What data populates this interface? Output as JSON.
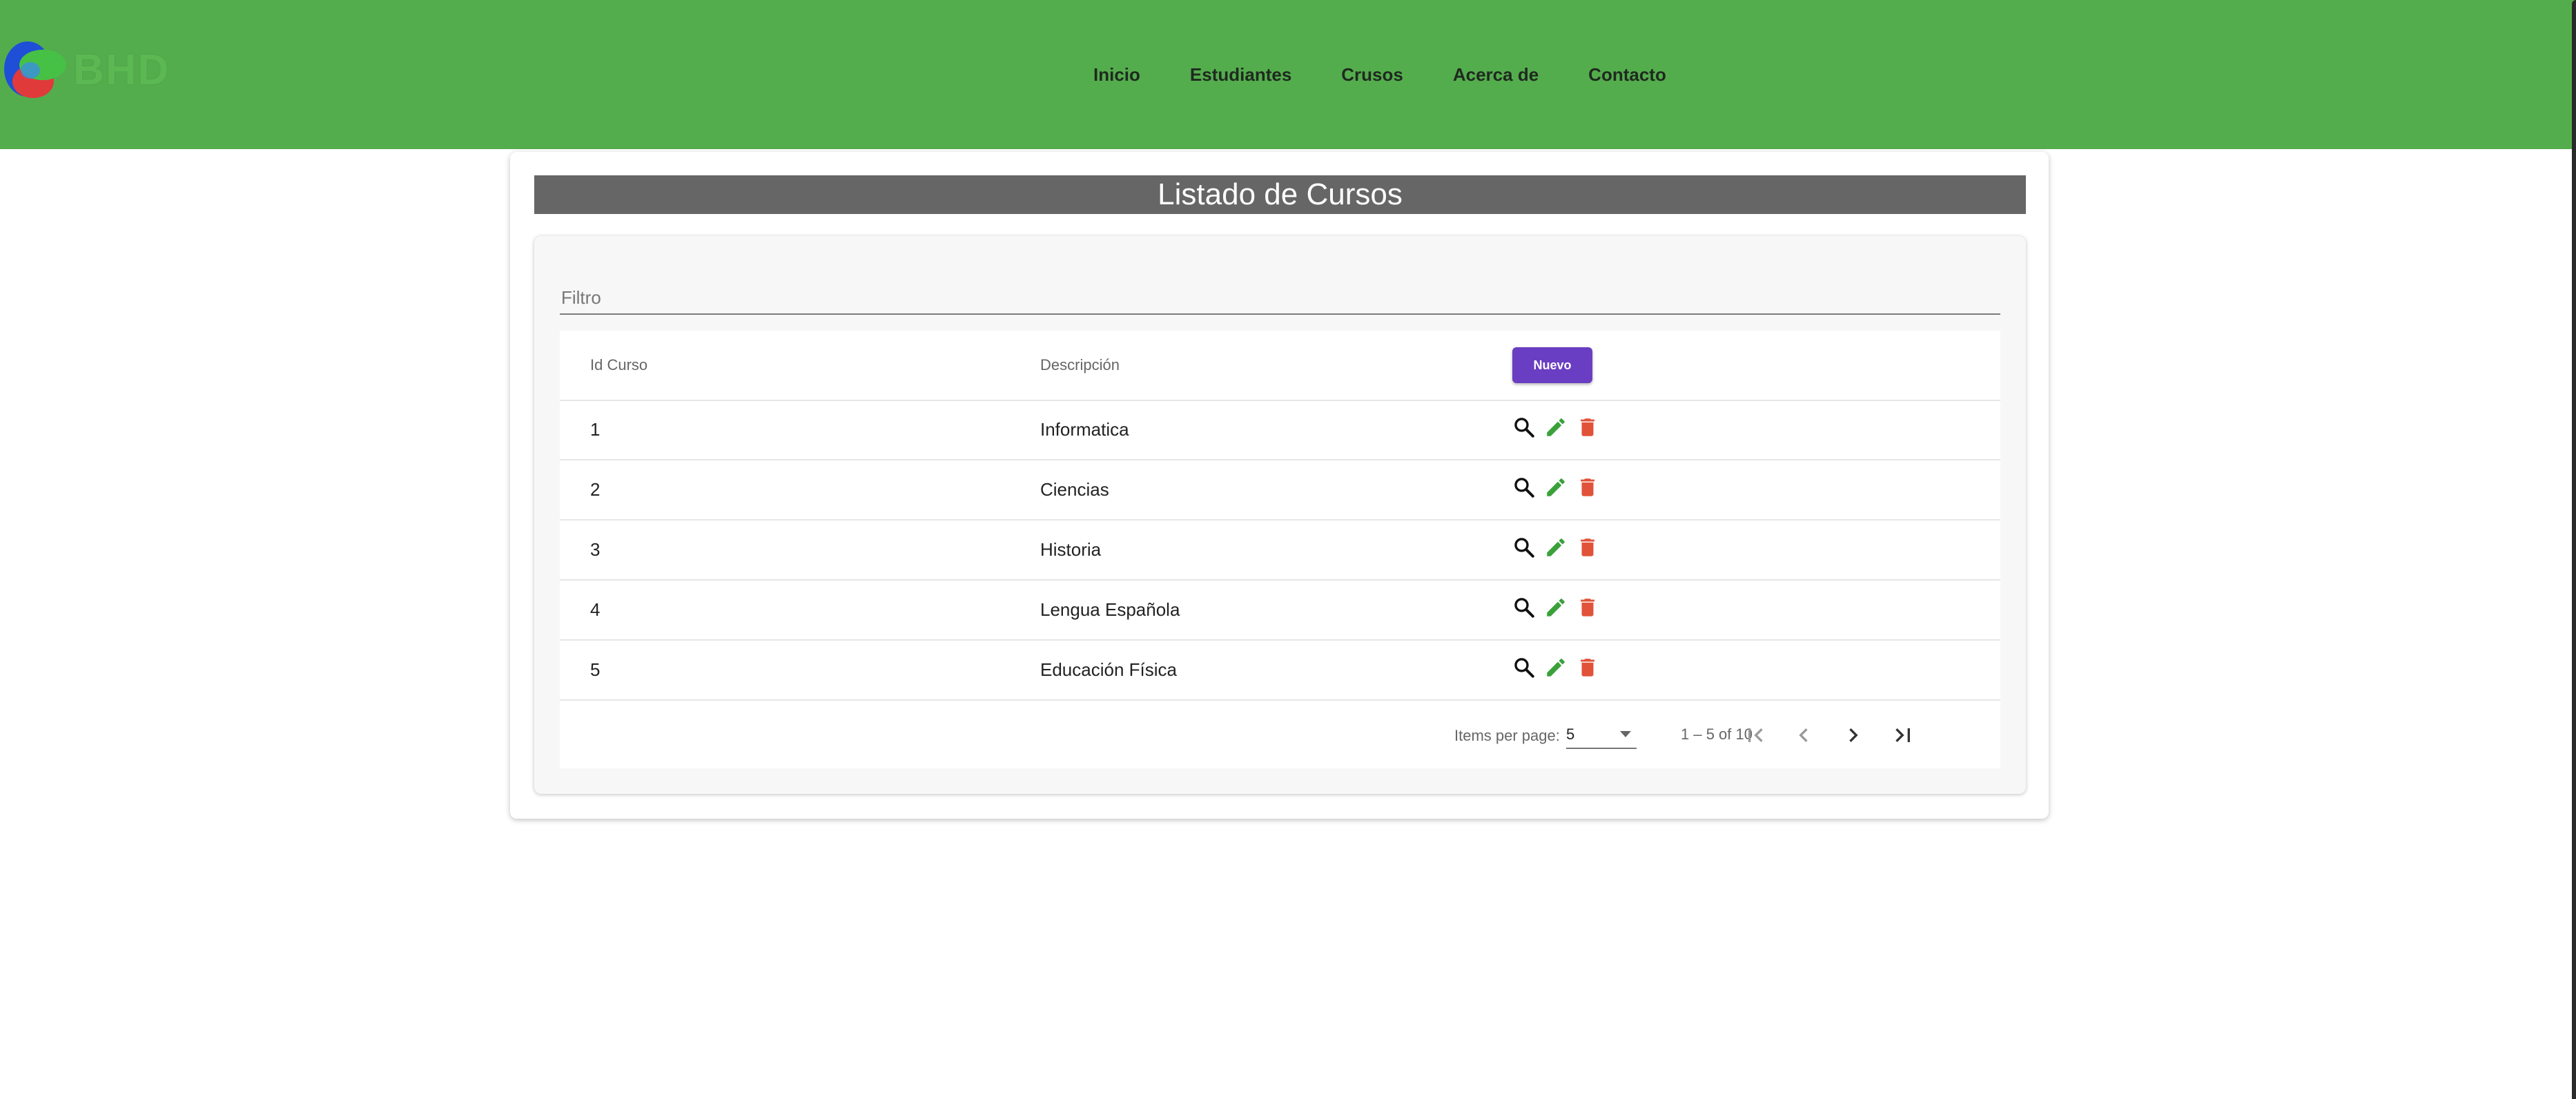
{
  "app": {
    "logo_text": "BHD",
    "colors": {
      "header": "#54ad4d",
      "primary_button": "#6a3ec2",
      "edit": "#3aa13a",
      "delete": "#e0533a"
    }
  },
  "nav": {
    "items": [
      "Inicio",
      "Estudiantes",
      "Crusos",
      "Acerca de",
      "Contacto"
    ]
  },
  "page": {
    "title": "Listado de Cursos"
  },
  "filter": {
    "placeholder": "Filtro",
    "value": ""
  },
  "table": {
    "headers": {
      "id": "Id Curso",
      "description": "Descripción",
      "new_button": "Nuevo"
    },
    "rows": [
      {
        "id": "1",
        "description": "Informatica"
      },
      {
        "id": "2",
        "description": "Ciencias"
      },
      {
        "id": "3",
        "description": "Historia"
      },
      {
        "id": "4",
        "description": "Lengua Española"
      },
      {
        "id": "5",
        "description": "Educación Física"
      }
    ],
    "row_actions": [
      "search-icon",
      "edit-icon",
      "delete-icon"
    ]
  },
  "paginator": {
    "items_per_page_label": "Items per page:",
    "items_per_page_value": "5",
    "range_label": "1 – 5 of 10",
    "buttons": [
      "first-page-icon",
      "previous-page-icon",
      "next-page-icon",
      "last-page-icon"
    ]
  }
}
